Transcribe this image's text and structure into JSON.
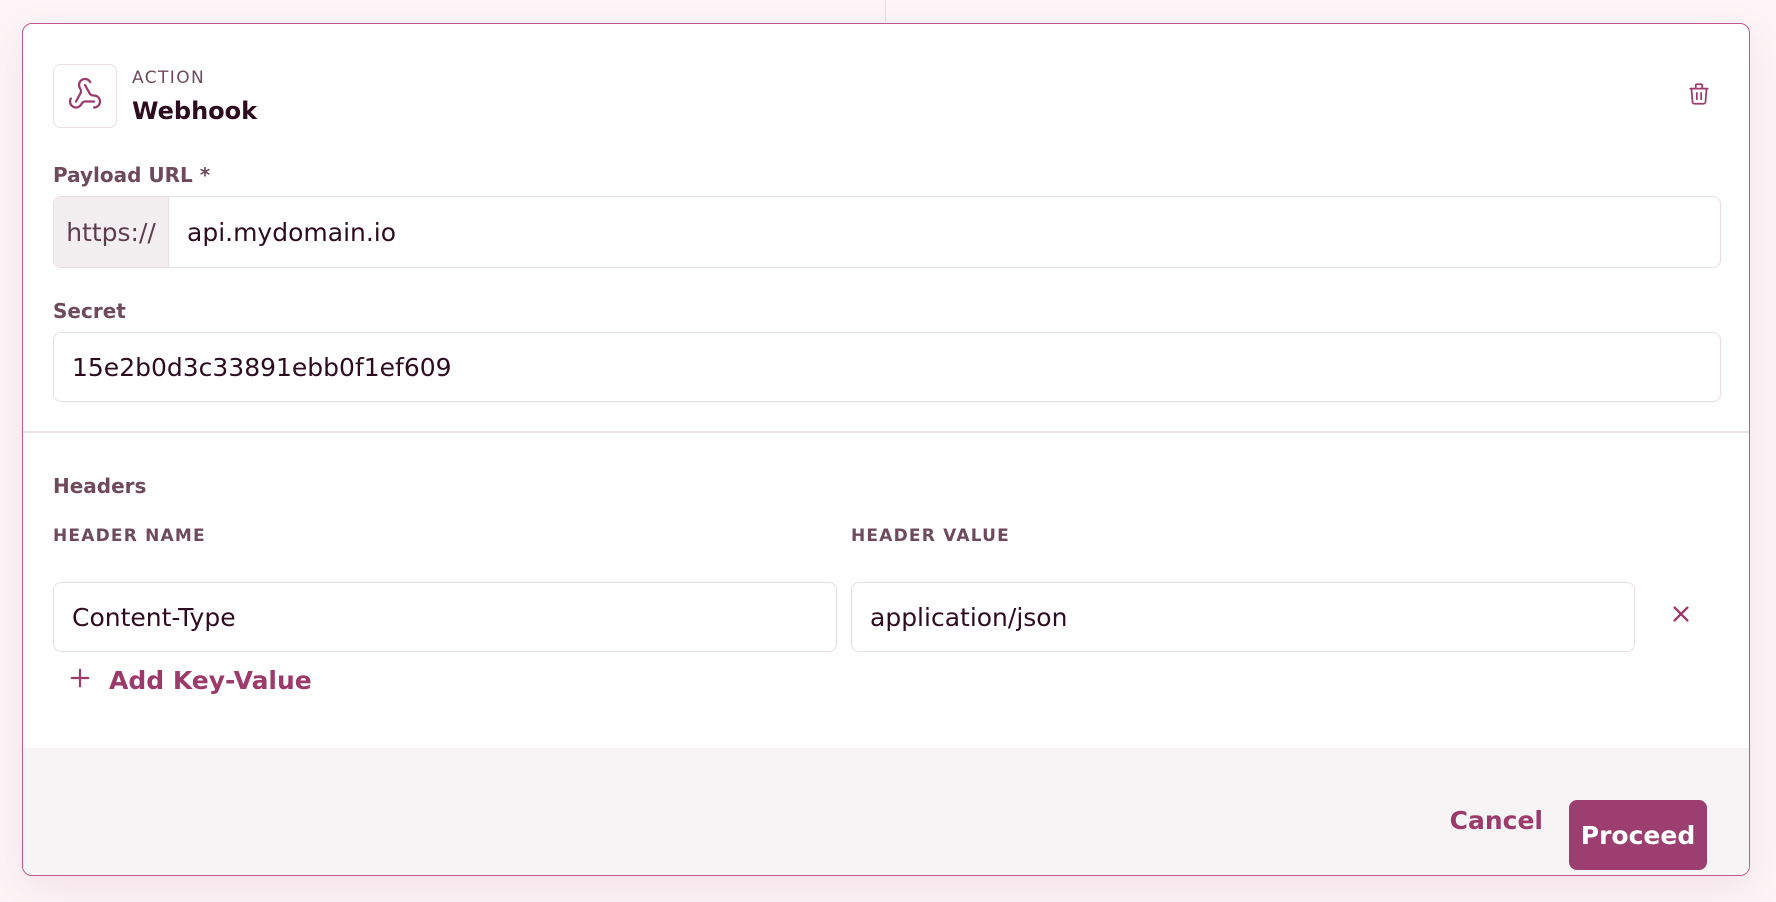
{
  "colors": {
    "accent": "#9c3f70",
    "border_accent": "#c0588a",
    "text_dark": "#2e0c20",
    "text_muted": "#6e4a5c",
    "footer_bg": "#f7f4f5"
  },
  "action": {
    "kicker": "ACTION",
    "title": "Webhook",
    "icon": "webhook-icon",
    "delete_icon": "trash-icon"
  },
  "payload_url": {
    "label": "Payload URL *",
    "prefix": "https://",
    "value": "api.mydomain.io"
  },
  "secret": {
    "label": "Secret",
    "value": "15e2b0d3c33891ebb0f1ef609"
  },
  "headers": {
    "label": "Headers",
    "name_column": "HEADER NAME",
    "value_column": "HEADER VALUE",
    "rows": [
      {
        "name": "Content-Type",
        "value": "application/json",
        "remove_icon": "close-icon"
      }
    ],
    "add_label": "Add Key-Value",
    "add_icon": "plus-icon"
  },
  "footer": {
    "cancel_label": "Cancel",
    "proceed_label": "Proceed"
  }
}
